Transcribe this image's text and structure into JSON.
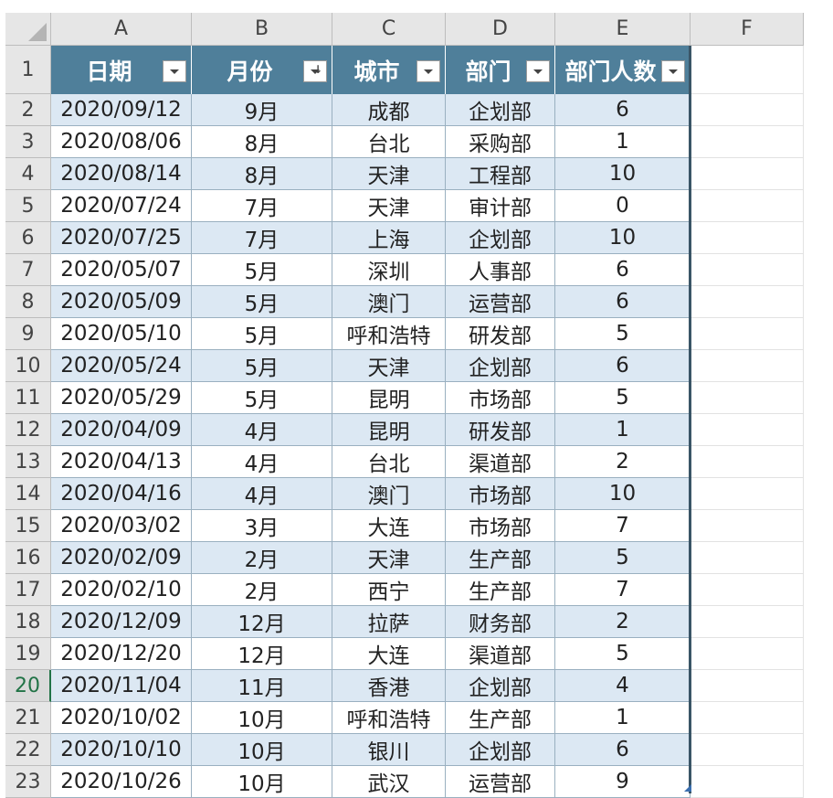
{
  "sheet": {
    "column_letters": [
      "A",
      "B",
      "C",
      "D",
      "E",
      "F"
    ],
    "row_numbers": [
      "1",
      "2",
      "3",
      "4",
      "5",
      "6",
      "7",
      "8",
      "9",
      "10",
      "11",
      "12",
      "13",
      "14",
      "15",
      "16",
      "17",
      "18",
      "19",
      "20",
      "21",
      "22",
      "23"
    ],
    "active_row": "20",
    "headers": [
      "日期",
      "月份",
      "城市",
      "部门",
      "部门人数"
    ],
    "rows": [
      [
        "2020/09/12",
        "9月",
        "成都",
        "企划部",
        "6"
      ],
      [
        "2020/08/06",
        "8月",
        "台北",
        "采购部",
        "1"
      ],
      [
        "2020/08/14",
        "8月",
        "天津",
        "工程部",
        "10"
      ],
      [
        "2020/07/24",
        "7月",
        "天津",
        "审计部",
        "0"
      ],
      [
        "2020/07/25",
        "7月",
        "上海",
        "企划部",
        "10"
      ],
      [
        "2020/05/07",
        "5月",
        "深圳",
        "人事部",
        "6"
      ],
      [
        "2020/05/09",
        "5月",
        "澳门",
        "运营部",
        "6"
      ],
      [
        "2020/05/10",
        "5月",
        "呼和浩特",
        "研发部",
        "5"
      ],
      [
        "2020/05/24",
        "5月",
        "天津",
        "企划部",
        "6"
      ],
      [
        "2020/05/29",
        "5月",
        "昆明",
        "市场部",
        "5"
      ],
      [
        "2020/04/09",
        "4月",
        "昆明",
        "研发部",
        "1"
      ],
      [
        "2020/04/13",
        "4月",
        "台北",
        "渠道部",
        "2"
      ],
      [
        "2020/04/16",
        "4月",
        "澳门",
        "市场部",
        "10"
      ],
      [
        "2020/03/02",
        "3月",
        "大连",
        "市场部",
        "7"
      ],
      [
        "2020/02/09",
        "2月",
        "天津",
        "生产部",
        "5"
      ],
      [
        "2020/02/10",
        "2月",
        "西宁",
        "生产部",
        "7"
      ],
      [
        "2020/12/09",
        "12月",
        "拉萨",
        "财务部",
        "2"
      ],
      [
        "2020/12/20",
        "12月",
        "大连",
        "渠道部",
        "5"
      ],
      [
        "2020/11/04",
        "11月",
        "香港",
        "企划部",
        "4"
      ],
      [
        "2020/10/02",
        "10月",
        "呼和浩特",
        "生产部",
        "1"
      ],
      [
        "2020/10/10",
        "10月",
        "银川",
        "企划部",
        "6"
      ],
      [
        "2020/10/26",
        "10月",
        "武汉",
        "运营部",
        "9"
      ]
    ],
    "filter_icons": [
      "filter-dropdown-icon",
      "sort-ascending-filter-icon",
      "filter-dropdown-icon",
      "filter-dropdown-icon",
      "filter-dropdown-icon"
    ],
    "colors": {
      "header_bg": "#4f7f9a",
      "band_bg": "#dce8f3",
      "active_row": "#217346"
    }
  }
}
